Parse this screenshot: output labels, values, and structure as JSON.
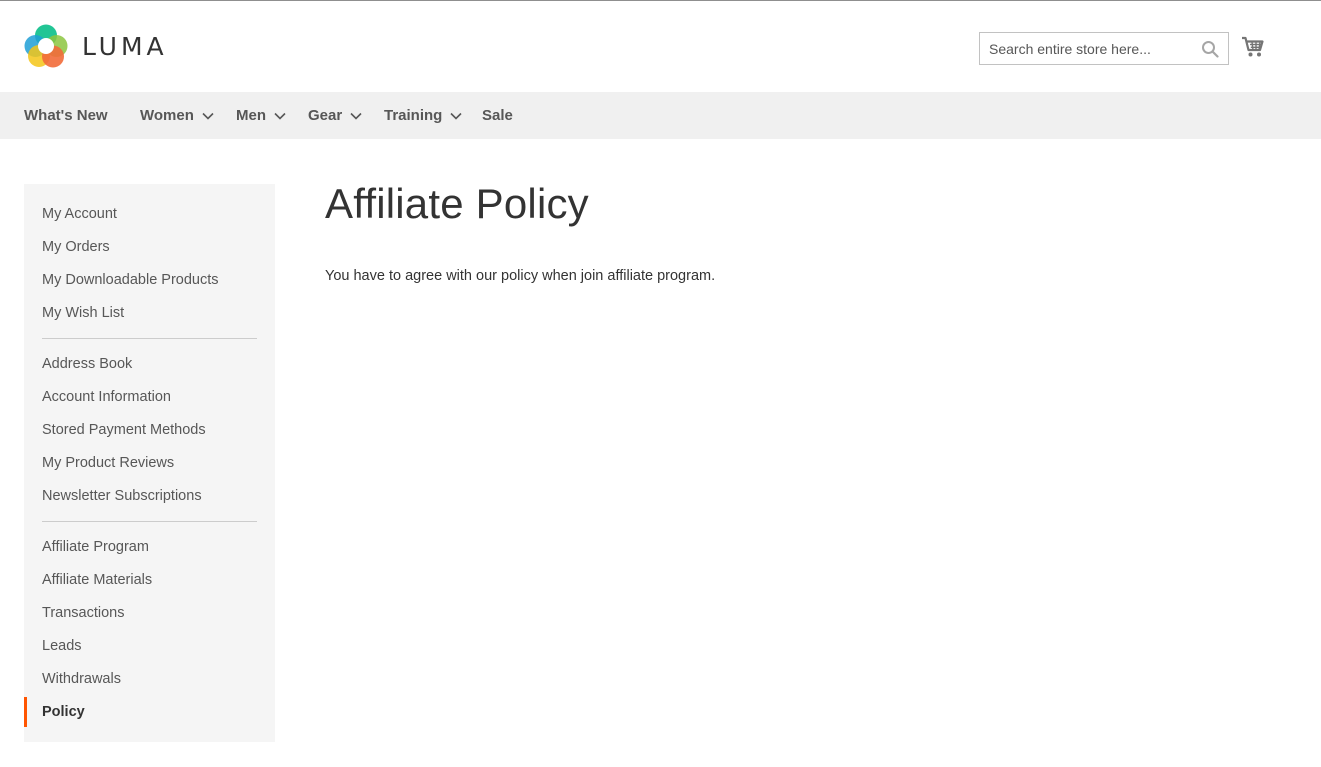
{
  "header": {
    "logo_text": "LUMA",
    "search": {
      "placeholder": "Search entire store here..."
    }
  },
  "nav": {
    "items": [
      {
        "label": "What's New",
        "has_dropdown": false
      },
      {
        "label": "Women",
        "has_dropdown": true
      },
      {
        "label": "Men",
        "has_dropdown": true
      },
      {
        "label": "Gear",
        "has_dropdown": true
      },
      {
        "label": "Training",
        "has_dropdown": true
      },
      {
        "label": "Sale",
        "has_dropdown": false
      }
    ]
  },
  "sidebar": {
    "groups": [
      [
        "My Account",
        "My Orders",
        "My Downloadable Products",
        "My Wish List"
      ],
      [
        "Address Book",
        "Account Information",
        "Stored Payment Methods",
        "My Product Reviews",
        "Newsletter Subscriptions"
      ],
      [
        "Affiliate Program",
        "Affiliate Materials",
        "Transactions",
        "Leads",
        "Withdrawals",
        "Policy"
      ]
    ],
    "active": "Policy"
  },
  "main": {
    "title": "Affiliate Policy",
    "body": "You have to agree with our policy when join affiliate program."
  },
  "colors": {
    "accent": "#ff5501",
    "nav_background": "#f0f0f0",
    "sidebar_background": "#f5f5f5"
  }
}
